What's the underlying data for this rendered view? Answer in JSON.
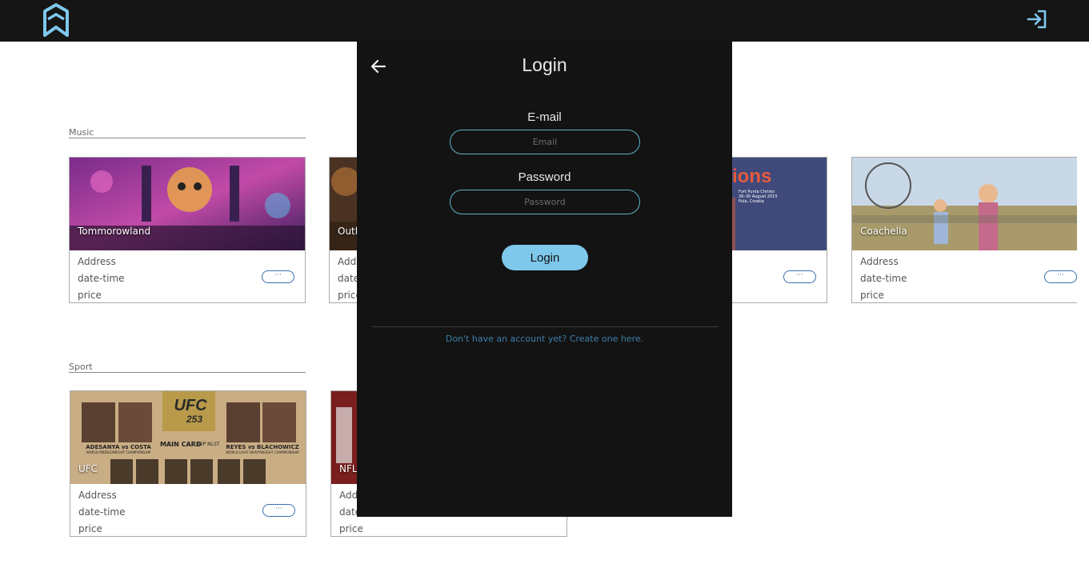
{
  "header": {
    "logo_icon": "bookmark-house-logo-icon",
    "login_icon": "sign-in-arrow-icon",
    "accent": "#7ec8ec"
  },
  "sections": [
    {
      "label": "Music",
      "cards": [
        {
          "title": "Tommorowland",
          "address": "Address",
          "datetime": "date-time",
          "price": "price",
          "more": "···"
        },
        {
          "title": "Outl",
          "address": "Add",
          "datetime": "date",
          "price": "price",
          "more": "···"
        },
        {
          "title": "",
          "banner_text": "ions",
          "banner_small": "Fort Punta Christo\n26–30 August 2015\nPula, Croatia",
          "address": "",
          "datetime": "",
          "price": "",
          "more": "···"
        },
        {
          "title": "Coachella",
          "address": "Address",
          "datetime": "date-time",
          "price": "price",
          "more": "···"
        }
      ]
    },
    {
      "label": "Sport",
      "cards": [
        {
          "title": "UFC",
          "address": "Address",
          "datetime": "date-time",
          "price": "price",
          "more": "···",
          "poster": {
            "logo": "UFC",
            "number": "253",
            "fight_left": "ADESANYA vs COSTA",
            "fight_left_sub": "WORLD MIDDLEWEIGHT CHAMPIONSHIP",
            "main_card": "MAIN CARD",
            "time": "12P NLST",
            "fight_right": "REYES vs BLACHOWICZ",
            "fight_right_sub": "WORLD LIGHT HEAVYWEIGHT CHAMPIONSHIP"
          }
        },
        {
          "title": "NFL",
          "address": "Add",
          "datetime": "date",
          "price": "price",
          "more": "···"
        }
      ]
    }
  ],
  "login_modal": {
    "title": "Login",
    "back_icon": "arrow-left-icon",
    "email_label": "E-mail",
    "email_placeholder": "Email",
    "email_value": "",
    "password_label": "Password",
    "password_placeholder": "Password",
    "password_value": "",
    "submit_label": "Login",
    "signup_text": "Don't have an account yet? Create one here."
  }
}
